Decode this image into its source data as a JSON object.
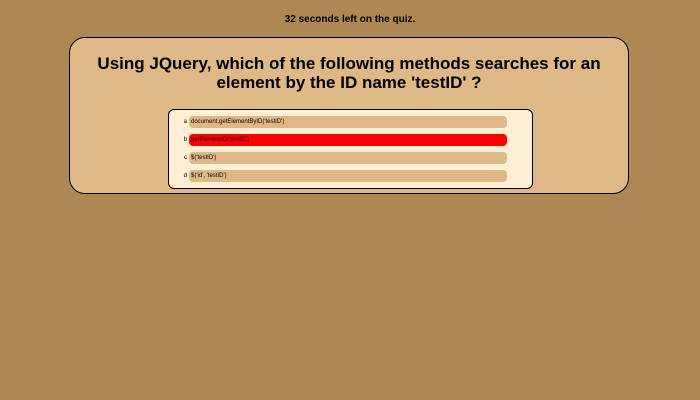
{
  "timer": {
    "text": "32 seconds left on the quiz."
  },
  "question": {
    "text": "Using JQuery, which of the following methods searches for an element by the ID name 'testID' ?"
  },
  "answers": [
    {
      "letter": "a",
      "text": "document.getElementByID('testID')"
    },
    {
      "letter": "b",
      "text": "getElementID('testID')"
    },
    {
      "letter": "c",
      "text": "$('testID')"
    },
    {
      "letter": "d",
      "text": "$('id', 'testID')"
    }
  ],
  "colors": {
    "background": "#ad8855",
    "card": "#deb887",
    "answers_panel": "#ffefd5",
    "option": "#deb887",
    "wrong_selection": "#ff0000"
  },
  "selected_answer": "b"
}
